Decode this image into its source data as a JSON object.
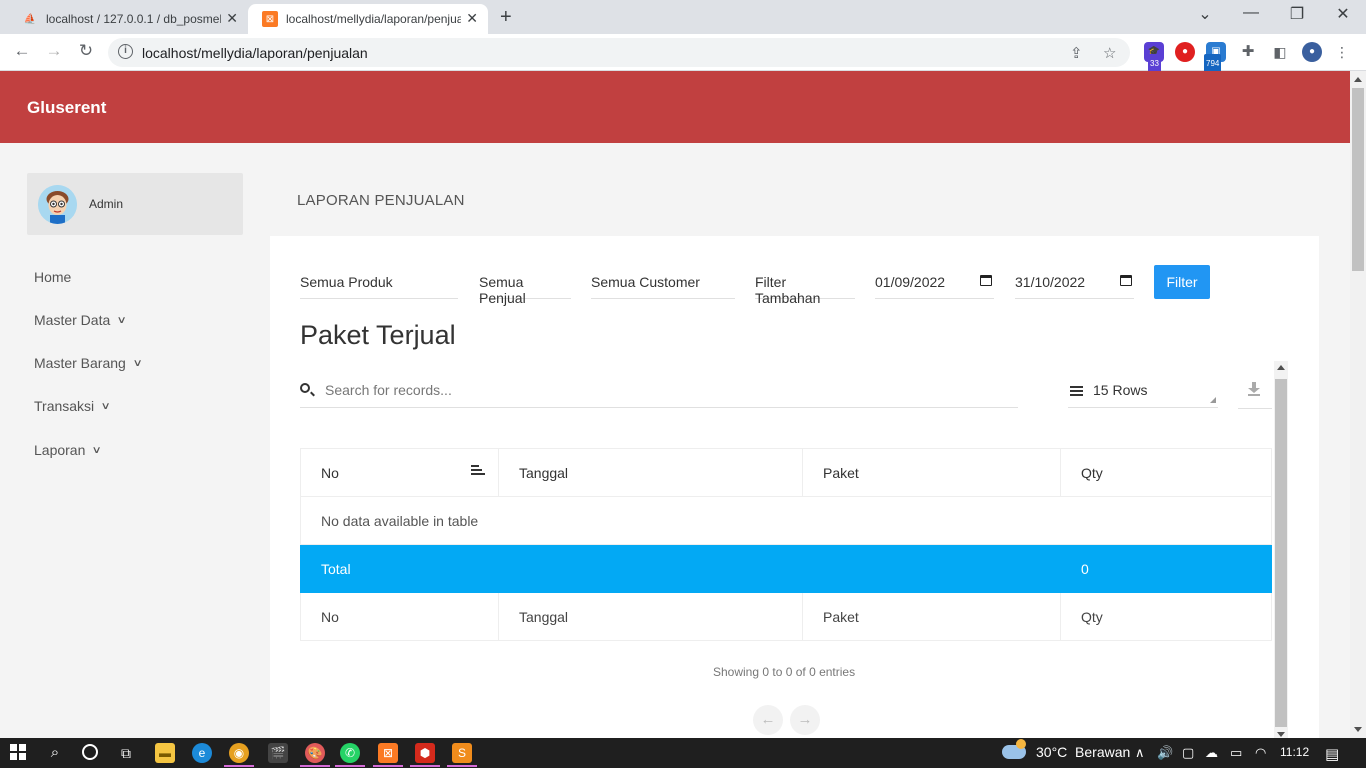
{
  "browser": {
    "tabs": [
      {
        "title": "localhost / 127.0.0.1 / db_posmelly",
        "active": false
      },
      {
        "title": "localhost/mellydia/laporan/penjualan",
        "active": true
      }
    ],
    "url": "localhost/mellydia/laporan/penjualan",
    "extensions": {
      "badge1": "33",
      "badge2": "794"
    }
  },
  "app": {
    "brand": "Gluserent",
    "user": {
      "name": "Admin"
    },
    "nav": [
      {
        "label": "Home",
        "has_dropdown": false
      },
      {
        "label": "Master Data",
        "has_dropdown": true
      },
      {
        "label": "Master Barang",
        "has_dropdown": true
      },
      {
        "label": "Transaksi",
        "has_dropdown": true
      },
      {
        "label": "Laporan",
        "has_dropdown": true
      }
    ],
    "page_title": "LAPORAN PENJUALAN"
  },
  "filters": {
    "produk": "Semua Produk",
    "penjual": "Semua Penjual",
    "customer": "Semua Customer",
    "tambahan": "Filter Tambahan",
    "date_from": "01/09/2022",
    "date_to": "31/10/2022",
    "button": "Filter"
  },
  "table": {
    "title": "Paket Terjual",
    "search_placeholder": "Search for records...",
    "rows_per_page": "15 Rows",
    "columns": [
      "No",
      "Tanggal",
      "Paket",
      "Qty"
    ],
    "empty_message": "No data available in table",
    "total_label": "Total",
    "total_value": "0",
    "footer_columns": [
      "No",
      "Tanggal",
      "Paket",
      "Qty"
    ],
    "info": "Showing 0 to 0 of 0 entries",
    "prev": "←",
    "next": "→"
  },
  "taskbar": {
    "weather": "30°C  Berawan",
    "time": "11:12"
  }
}
